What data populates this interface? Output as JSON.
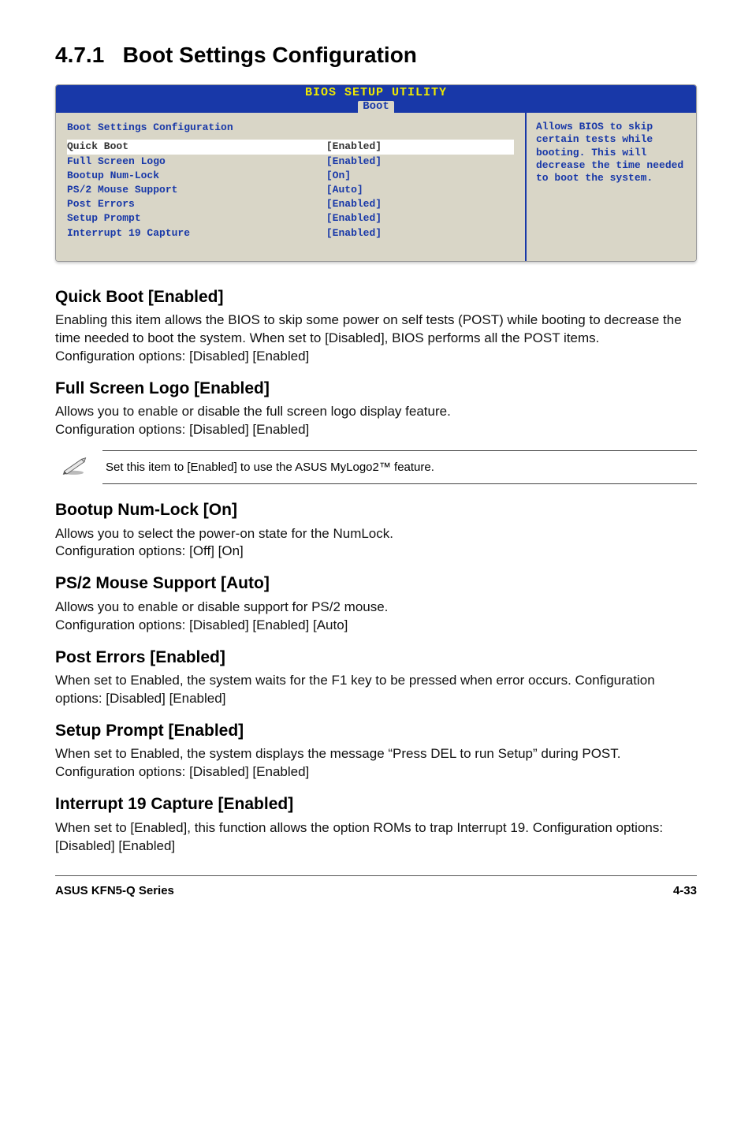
{
  "section": {
    "number": "4.7.1",
    "title": "Boot Settings Configuration"
  },
  "bios": {
    "header_title": "BIOS SETUP UTILITY",
    "header_tab": "Boot",
    "panel_heading": "Boot Settings Configuration",
    "rows": [
      {
        "label": "Quick Boot",
        "value": "[Enabled]",
        "highlight": true
      },
      {
        "label": "Full Screen Logo",
        "value": "[Enabled]"
      },
      {
        "label": "Bootup Num-Lock",
        "value": "[On]"
      },
      {
        "label": "PS/2 Mouse Support",
        "value": "[Auto]"
      },
      {
        "label": "Post Errors",
        "value": "[Enabled]"
      },
      {
        "label": "Setup Prompt",
        "value": "[Enabled]"
      },
      {
        "label": "Interrupt 19 Capture",
        "value": "[Enabled]"
      }
    ],
    "help_text": "Allows BIOS to skip certain tests while booting. This will decrease the time needed to boot the system."
  },
  "options": {
    "quick_boot": {
      "title": "Quick Boot [Enabled]",
      "body1": "Enabling this item allows the BIOS to skip some power on self tests (POST) while booting to decrease the time needed to boot the system. When set to [Disabled], BIOS performs all the POST items.",
      "body2": "Configuration options: [Disabled] [Enabled]"
    },
    "full_screen_logo": {
      "title": "Full Screen Logo [Enabled]",
      "body1": "Allows you to enable or disable the full screen logo display feature.",
      "body2": "Configuration options: [Disabled] [Enabled]",
      "note": "Set this item to [Enabled] to use the ASUS MyLogo2™ feature."
    },
    "bootup_numlock": {
      "title": "Bootup Num-Lock [On]",
      "body1": "Allows you to select the power-on state for the NumLock.",
      "body2": "Configuration options: [Off] [On]"
    },
    "ps2_mouse": {
      "title": "PS/2 Mouse Support [Auto]",
      "body1": "Allows you to enable or disable support for PS/2 mouse.",
      "body2": "Configuration options: [Disabled] [Enabled] [Auto]"
    },
    "post_errors": {
      "title": "Post Errors [Enabled]",
      "body1": "When set to Enabled, the system waits for the F1 key to be pressed when error occurs. Configuration options: [Disabled] [Enabled]"
    },
    "setup_prompt": {
      "title": "Setup Prompt [Enabled]",
      "body1": "When set to Enabled, the system displays the message “Press DEL to run Setup” during POST. Configuration options: [Disabled] [Enabled]"
    },
    "interrupt19": {
      "title": "Interrupt 19 Capture [Enabled]",
      "body1": "When set to [Enabled], this function allows the option ROMs to trap Interrupt 19. Configuration options: [Disabled] [Enabled]"
    }
  },
  "footer": {
    "left": "ASUS KFN5-Q Series",
    "right": "4-33"
  },
  "icons": {
    "pencil": "pencil-note-icon"
  }
}
